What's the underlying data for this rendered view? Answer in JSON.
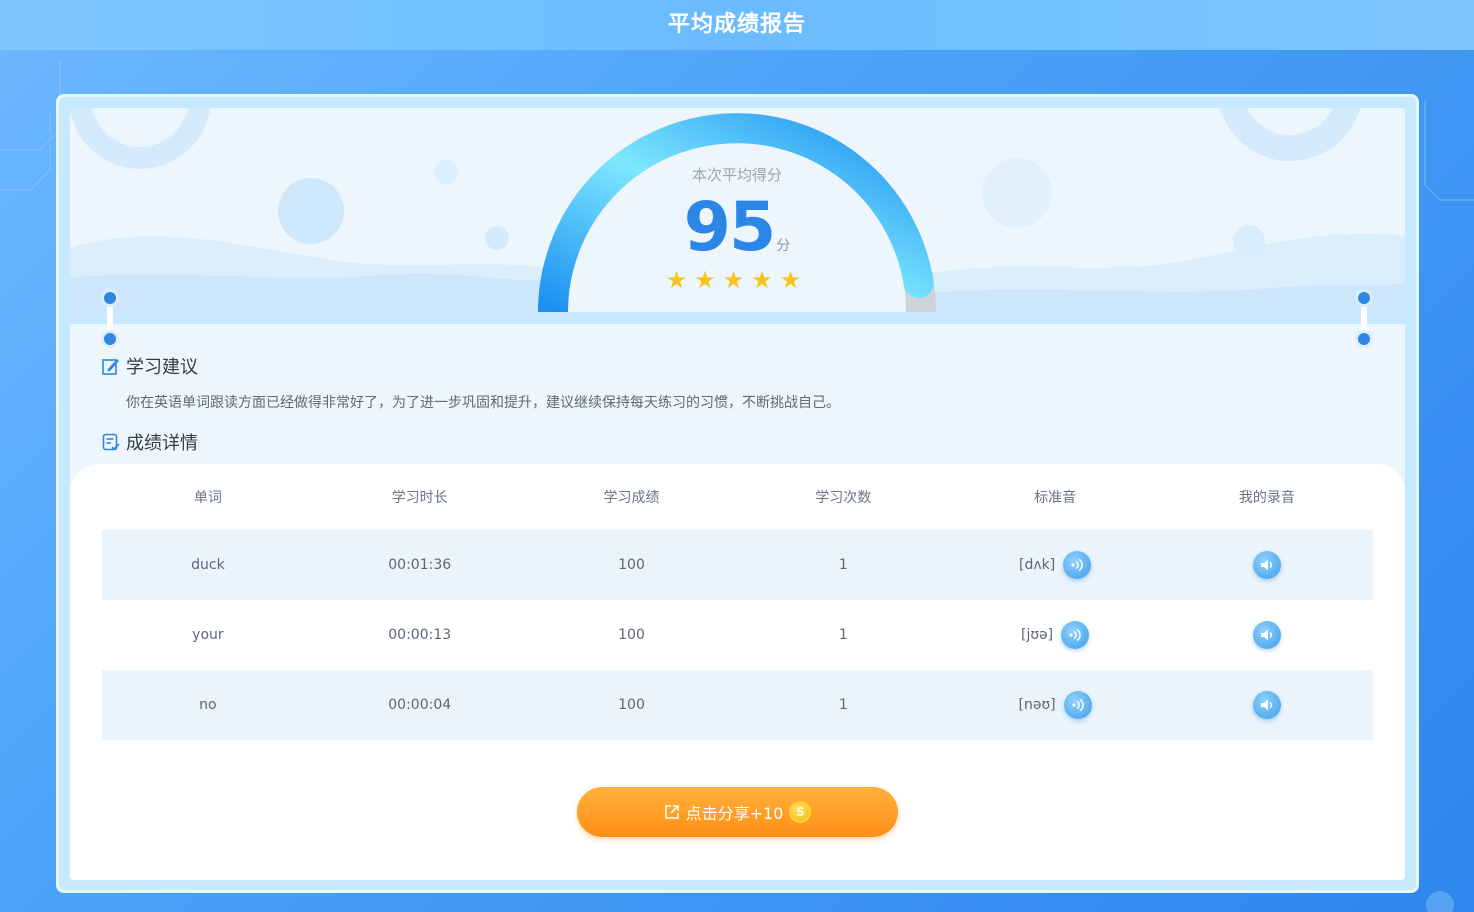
{
  "page": {
    "title": "平均成绩报告"
  },
  "score": {
    "label": "本次平均得分",
    "value": "95",
    "unit": "分",
    "stars": "★★★★★",
    "rating": 5,
    "rating_max": 5,
    "gauge_fraction": 0.95
  },
  "advice": {
    "heading": "学习建议",
    "text": "你在英语单词跟读方面已经做得非常好了，为了进一步巩固和提升，建议继续保持每天练习的习惯，不断挑战自己。"
  },
  "details": {
    "heading": "成绩详情",
    "columns": [
      "单词",
      "学习时长",
      "学习成绩",
      "学习次数",
      "标准音",
      "我的录音"
    ],
    "rows": [
      {
        "word": "duck",
        "duration": "00:01:36",
        "score": "100",
        "count": "1",
        "phonetic": "[dʌk]"
      },
      {
        "word": "your",
        "duration": "00:00:13",
        "score": "100",
        "count": "1",
        "phonetic": "[jʊə]"
      },
      {
        "word": "no",
        "duration": "00:00:04",
        "score": "100",
        "count": "1",
        "phonetic": "[nəʊ]"
      }
    ]
  },
  "share": {
    "label": "点击分享+10",
    "coin_symbol": "S"
  },
  "icons": {
    "advice": "edit-note-icon",
    "details": "report-list-icon",
    "standard_audio": "speaker-wave-icon",
    "my_recording": "speaker-volume-icon",
    "share": "external-share-icon",
    "coin": "coin-icon"
  },
  "colors": {
    "accent": "#2b86e8",
    "gauge_start": "#7ee8ff",
    "gauge_end": "#1a8ff0",
    "star": "#f8c31c",
    "share_button": "#ff9a22",
    "row_shade": "#eaf4fc"
  }
}
